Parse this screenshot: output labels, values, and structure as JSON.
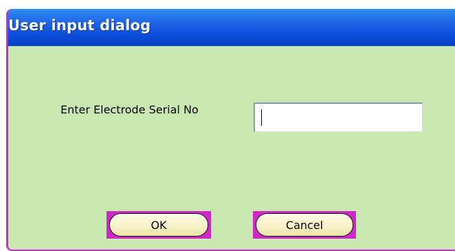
{
  "dialog": {
    "title": "User input dialog",
    "field_label": "Enter Electrode Serial No",
    "serial_input": {
      "value": "",
      "placeholder": ""
    },
    "buttons": {
      "ok_label": "OK",
      "cancel_label": "Cancel"
    }
  },
  "colors": {
    "titlebar": "#1f66e8",
    "body": "#c9e7b1",
    "accent_border": "#d028c8",
    "button_fill": "#f7f2c8"
  }
}
